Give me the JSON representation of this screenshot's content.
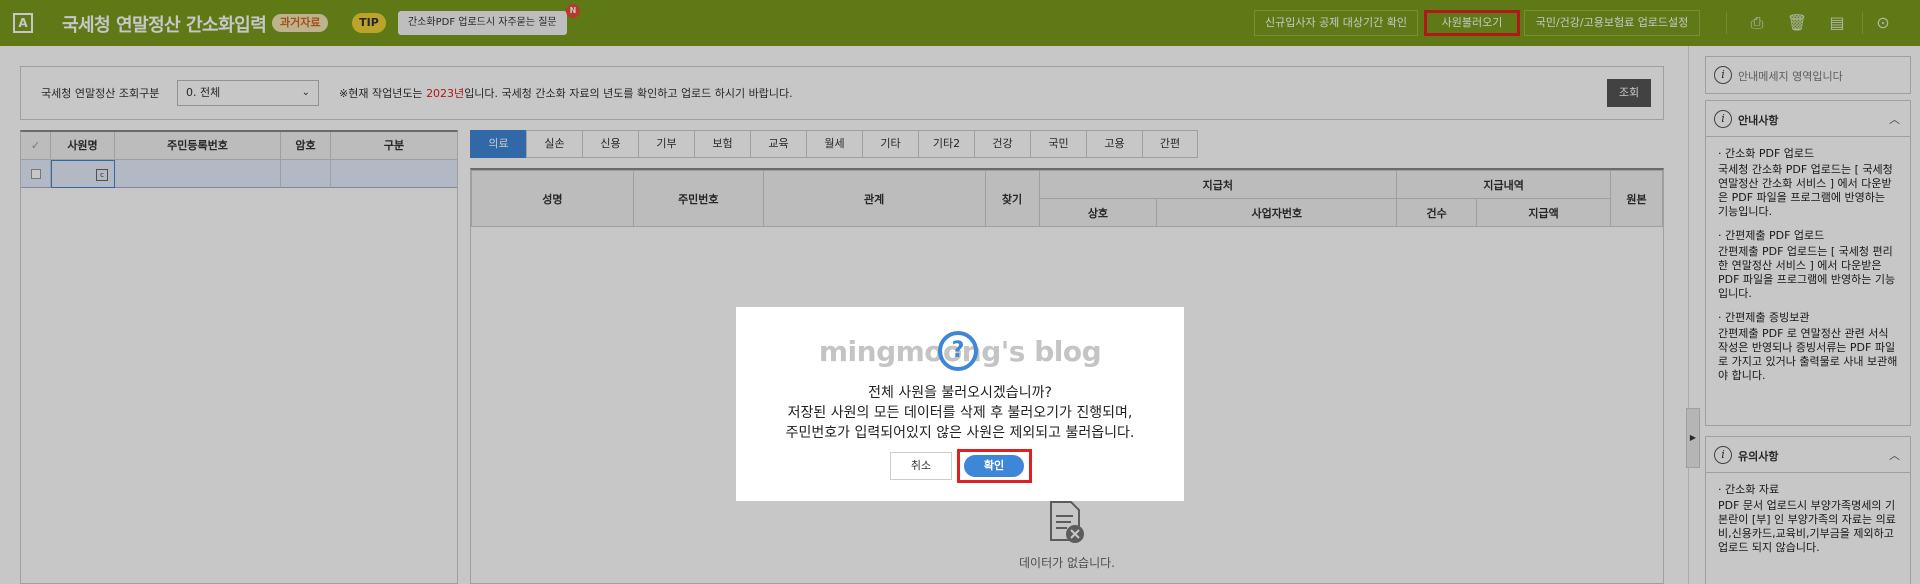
{
  "topbar": {
    "app_icon": "A",
    "title": "국세청 연말정산 간소화입력",
    "past_badge": "과거자료",
    "tip_badge": "TIP",
    "tip_text": "간소화PDF 업로드시 자주묻는 질문",
    "tip_new": "N",
    "buttons": [
      {
        "label": "신규입사자 공제 대상기간 확인"
      },
      {
        "label": "사원불러오기"
      },
      {
        "label": "국민/건강/고용보험료 업로드설정"
      }
    ],
    "icons": [
      "print-icon",
      "trash-icon",
      "settings-icon",
      "more-icon"
    ]
  },
  "filter": {
    "label": "국세청 연말정산 조회구분",
    "select_value": "0. 전체",
    "note_prefix": "※현재 작업년도는 ",
    "note_year": "2023년",
    "note_suffix": "입니다. 국세청 간소화 자료의 년도를 확인하고 업로드 하시기 바랍니다.",
    "search_button": "조회"
  },
  "left_table": {
    "headers": [
      "✓",
      "사원명",
      "주민등록번호",
      "암호",
      "구분"
    ]
  },
  "tabs": [
    "의료",
    "실손",
    "신용",
    "기부",
    "보험",
    "교육",
    "월세",
    "기타",
    "기타2",
    "건강",
    "국민",
    "고용",
    "간편"
  ],
  "right_table": {
    "headers": {
      "name": "성명",
      "rrn": "주민번호",
      "relation": "관계",
      "find": "찾기",
      "payee": "지급처",
      "payee_name": "상호",
      "payee_bizno": "사업자번호",
      "payment": "지급내역",
      "count": "건수",
      "amount": "지급액",
      "original": "원본"
    },
    "empty_text": "데이터가 없습니다."
  },
  "right_panel": {
    "message_area": "안내메세지 영역입니다",
    "guide_title": "안내사항",
    "guide_sections": [
      {
        "title": "· 간소화 PDF 업로드",
        "text": "국세청 간소화 PDF 업로드는 [ 국세청 연말정산 간소화 서비스 ] 에서 다운받은 PDF 파일을 프로그램에 반영하는 기능입니다."
      },
      {
        "title": "· 간편제출 PDF 업로드",
        "text": "간편제출 PDF 업로드는 [ 국세청 편리한 연말정산 서비스 ] 에서 다운받은 PDF 파일을 프로그램에 반영하는 기능입니다."
      },
      {
        "title": "· 간편제출 증빙보관",
        "text": "간편제출 PDF 로 연말정산 관련 서식작성은 반영되나 증빙서류는 PDF 파일로 가지고 있거나 출력물로 사내 보관해야 합니다."
      }
    ],
    "notice_title": "유의사항",
    "notice_sections": [
      {
        "title": "· 간소화 자료",
        "text": "PDF 문서 업로드시 부양가족명세의 기본란이 [부] 인 부양가족의 자료는 의료비,신용카드,교육비,기부금을 제외하고 업로드 되지 않습니다."
      }
    ]
  },
  "dialog": {
    "watermark": "mingmoong's blog",
    "icon": "question-icon",
    "line1": "전체 사원을 불러오시겠습니까?",
    "line2": "저장된 사원의 모든 데이터를 삭제 후 불러오기가 진행되며,",
    "line3": "주민번호가 입력되어있지 않은 사원은 제외되고 불러옵니다.",
    "cancel": "취소",
    "ok": "확인"
  }
}
